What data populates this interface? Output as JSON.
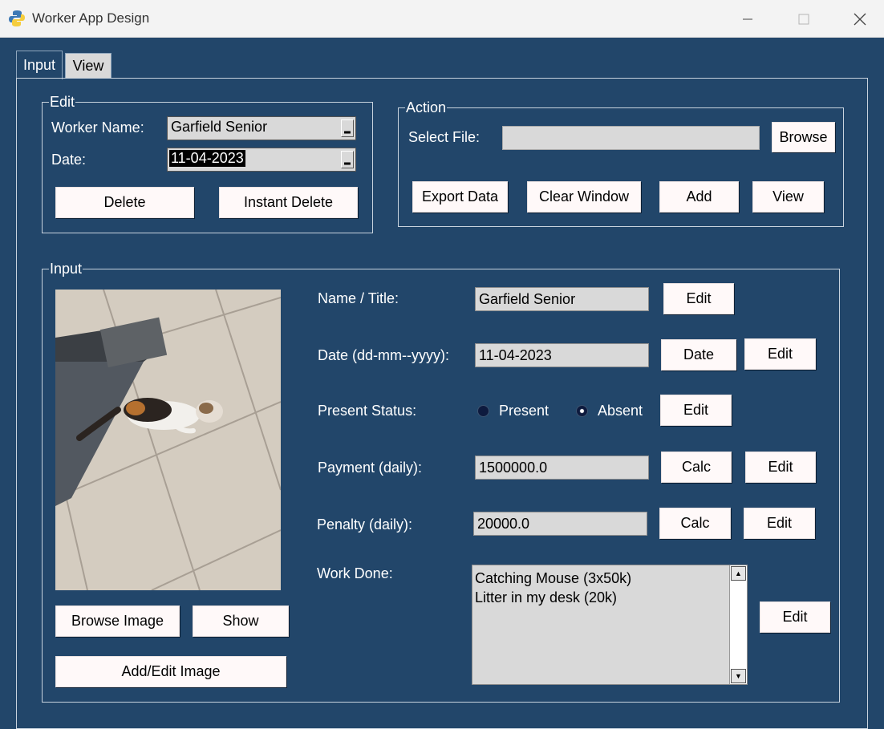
{
  "window": {
    "title": "Worker App Design"
  },
  "tabs": [
    {
      "label": "Input"
    },
    {
      "label": "View"
    }
  ],
  "edit_frame": {
    "legend": "Edit",
    "worker_name_label": "Worker Name:",
    "worker_name_value": "Garfield Senior",
    "date_label": "Date:",
    "date_value": "11-04-2023",
    "delete_label": "Delete",
    "instant_delete_label": "Instant Delete"
  },
  "action_frame": {
    "legend": "Action",
    "select_file_label": "Select File:",
    "select_file_value": "",
    "browse_label": "Browse",
    "export_label": "Export Data",
    "clear_label": "Clear Window",
    "add_label": "Add",
    "view_label": "View"
  },
  "input_frame": {
    "legend": "Input",
    "browse_image_label": "Browse Image",
    "show_label": "Show",
    "add_edit_image_label": "Add/Edit Image",
    "name_label": "Name / Title:",
    "name_value": "Garfield Senior",
    "date_label": "Date (dd-mm--yyyy):",
    "date_value": "11-04-2023",
    "date_button": "Date",
    "status_label": "Present Status:",
    "status_options": [
      "Present",
      "Absent"
    ],
    "status_selected": "Absent",
    "payment_label": "Payment (daily):",
    "payment_value": "1500000.0",
    "penalty_label": "Penalty (daily):",
    "penalty_value": "20000.0",
    "calc_label": "Calc",
    "edit_label": "Edit",
    "work_done_label": "Work Done:",
    "work_done_lines": [
      "Catching Mouse (3x50k)",
      "Litter in my desk (20k)"
    ]
  },
  "colors": {
    "background": "#22466a",
    "button": "#fff9f9",
    "entry": "#d9d9d9"
  }
}
